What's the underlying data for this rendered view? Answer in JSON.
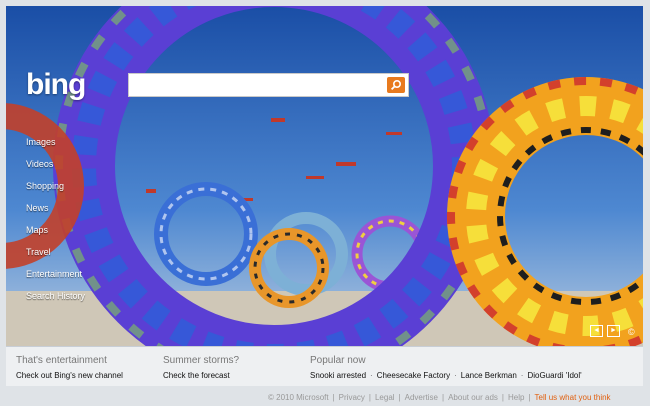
{
  "brand": {
    "logo_text": "bing"
  },
  "search": {
    "placeholder": "",
    "value": ""
  },
  "nav": {
    "items": [
      {
        "label": "Images"
      },
      {
        "label": "Videos"
      },
      {
        "label": "Shopping"
      },
      {
        "label": "News"
      },
      {
        "label": "Maps"
      },
      {
        "label": "Travel"
      },
      {
        "label": "Entertainment"
      },
      {
        "label": "Search History"
      }
    ]
  },
  "image_controls": {
    "prev_icon": "◄",
    "next_icon": "►",
    "info_icon": "©"
  },
  "bottom_bar": {
    "entertainment": {
      "heading": "That's entertainment",
      "link": "Check out Bing's new channel"
    },
    "weather": {
      "heading": "Summer storms?",
      "link": "Check the forecast"
    },
    "popular": {
      "heading": "Popular now",
      "links": [
        "Snooki arrested",
        "Cheesecake Factory",
        "Lance Berkman",
        "DioGuardi 'Idol'"
      ],
      "separator": "·"
    }
  },
  "footer": {
    "copyright": "© 2010 Microsoft",
    "links": [
      "Privacy",
      "Legal",
      "Advertise",
      "About our ads",
      "Help"
    ],
    "feedback": "Tell us what you think",
    "separator": "|"
  },
  "colors": {
    "accent": "#e87a1e",
    "feedback": "#e06010"
  }
}
